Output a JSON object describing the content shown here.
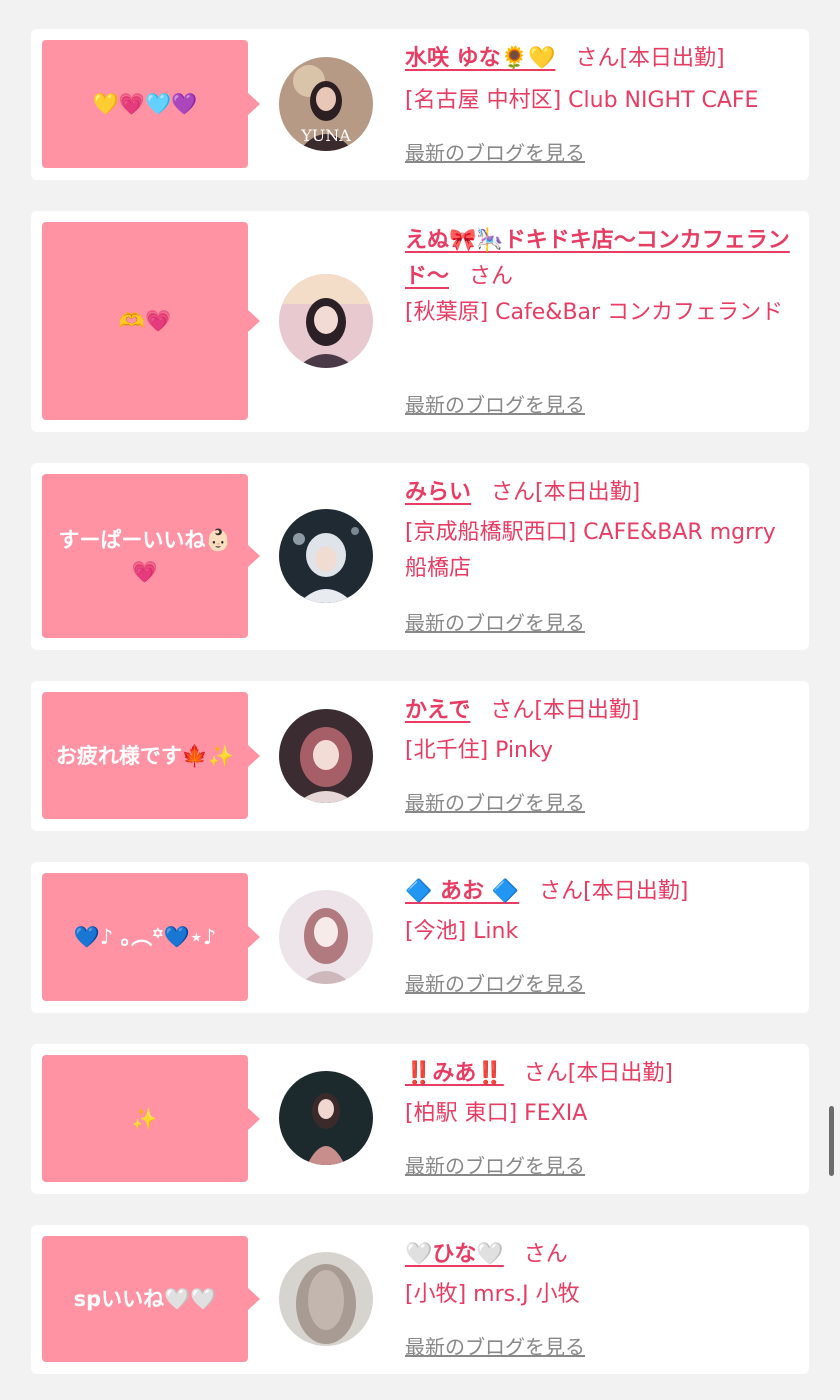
{
  "colors": {
    "accent": "#e83c63",
    "bubble": "#ff93a4",
    "background": "#f2f2f2",
    "card": "#ffffff",
    "link_gray": "#888888"
  },
  "entries": [
    {
      "bubble_text": "💛💗🩵💜",
      "name": "水咲 ゆな🌻💛",
      "suffix": "さん[本日出勤]",
      "shop": "[名古屋 中村区] Club NIGHT CAFE",
      "blog_label": "最新のブログを見る",
      "avatar_label": "YUNA"
    },
    {
      "bubble_text": "🫶💗",
      "name": "えぬ🎀🎠ドキドキ店〜コンカフェランド〜",
      "suffix": "さん",
      "shop": "[秋葉原] Cafe&Bar コンカフェランド",
      "blog_label": "最新のブログを見る"
    },
    {
      "bubble_text": "すーぱーいいね👶🏻💗",
      "name": "みらい",
      "suffix": "さん[本日出勤]",
      "shop": "[京成船橋駅西口] CAFE&BAR mgrry 船橋店",
      "blog_label": "最新のブログを見る"
    },
    {
      "bubble_text": "お疲れ様です🍁✨",
      "name": "かえで",
      "suffix": "さん[本日出勤]",
      "shop": "[北千住] Pinky",
      "blog_label": "最新のブログを見る"
    },
    {
      "bubble_text": "💙♪ ｡︵꙳💙⋆♪",
      "name": "🔷 あお 🔷",
      "suffix": "さん[本日出勤]",
      "shop": "[今池] Link",
      "blog_label": "最新のブログを見る"
    },
    {
      "bubble_text": "✨",
      "name": "‼️みあ‼️",
      "suffix": "さん[本日出勤]",
      "shop": "[柏駅 東口] FEXIA",
      "blog_label": "最新のブログを見る"
    },
    {
      "bubble_text": "spいいね🤍🤍",
      "name": "🤍ひな🤍",
      "suffix": "さん",
      "shop": "[小牧] mrs.J 小牧",
      "blog_label": "最新のブログを見る"
    }
  ]
}
